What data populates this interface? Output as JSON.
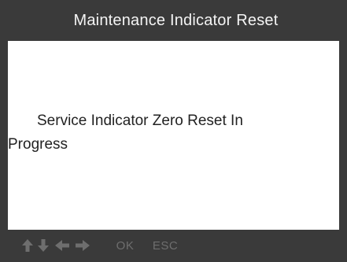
{
  "header": {
    "title": "Maintenance Indicator Reset"
  },
  "screen": {
    "message": "Service Indicator Zero Reset In Progress"
  },
  "footer": {
    "keys": [
      {
        "icon": "arrow-up-icon"
      },
      {
        "icon": "arrow-down-icon"
      },
      {
        "icon": "arrow-left-icon"
      },
      {
        "icon": "arrow-right-icon"
      }
    ],
    "ok_label": "OK",
    "esc_label": "ESC"
  },
  "colors": {
    "frame": "#3a3a3a",
    "screen": "#ffffff",
    "title_text": "#f4f4f4",
    "key_text": "#6e6e6e"
  }
}
